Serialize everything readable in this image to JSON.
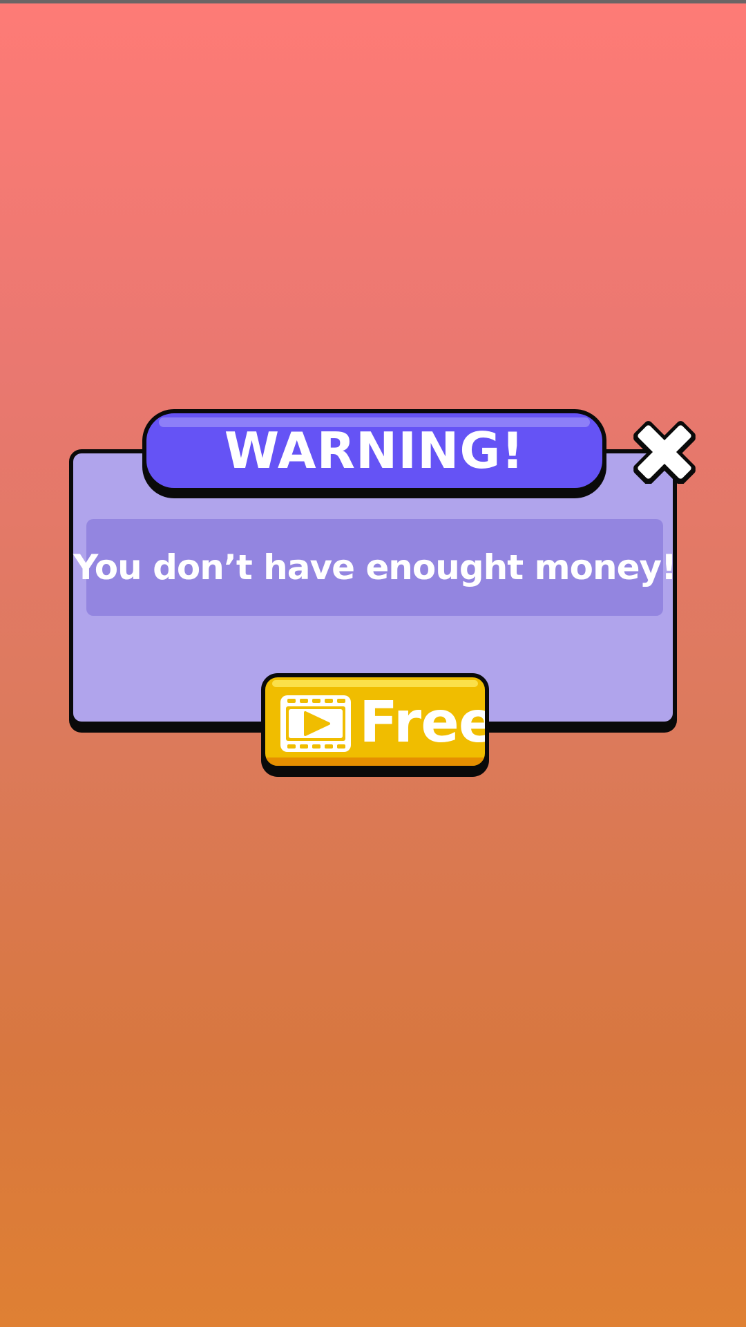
{
  "dialog": {
    "title": "WARNING!",
    "message": "You don’t have enought money!",
    "close_icon": "close-icon",
    "free_button": {
      "label": "Free",
      "icon": "video-play-icon"
    }
  },
  "colors": {
    "background_top": "#fe7b76",
    "background_bottom": "#df8033",
    "panel": "#b0a4ec",
    "message_box": "#9385e0",
    "title_banner": "#6553f5",
    "free_button": "#f0bd00",
    "outline": "#0a0a0a"
  }
}
